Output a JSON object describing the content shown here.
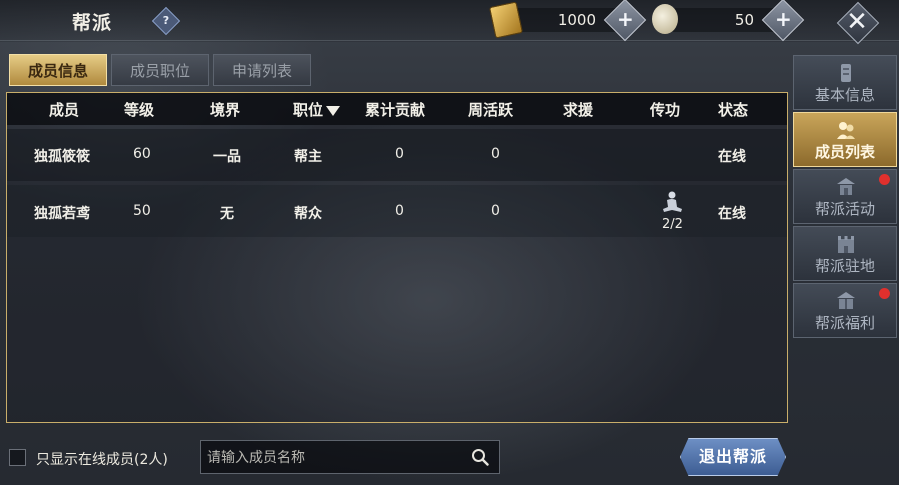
{
  "window": {
    "title": "帮派",
    "help_symbol": "?"
  },
  "resources": {
    "gold": {
      "icon": "gold-ingot-icon",
      "value": "1000"
    },
    "silver": {
      "icon": "silver-coin-icon",
      "value": "50"
    },
    "add_symbol": "+"
  },
  "close_symbol": "✕",
  "tabs": [
    {
      "label": "成员信息",
      "active": true
    },
    {
      "label": "成员职位",
      "active": false
    },
    {
      "label": "申请列表",
      "active": false
    }
  ],
  "table": {
    "columns": [
      "成员",
      "等级",
      "境界",
      "职位",
      "累计贡献",
      "周活跃",
      "求援",
      "传功",
      "状态"
    ],
    "rows": [
      {
        "name": "独孤筱筱",
        "level": "60",
        "realm": "一品",
        "position": "帮主",
        "contribution": "0",
        "weekly_active": "0",
        "assist": "",
        "teach": "",
        "status": "在线"
      },
      {
        "name": "独孤若鸢",
        "level": "50",
        "realm": "无",
        "position": "帮众",
        "contribution": "0",
        "weekly_active": "0",
        "assist": "",
        "teach": "2/2",
        "status": "在线"
      }
    ]
  },
  "side_nav": [
    {
      "label": "基本信息",
      "icon": "info-scroll-icon",
      "active": false,
      "badge": false
    },
    {
      "label": "成员列表",
      "icon": "members-icon",
      "active": true,
      "badge": false
    },
    {
      "label": "帮派活动",
      "icon": "pavilion-icon",
      "active": false,
      "badge": true
    },
    {
      "label": "帮派驻地",
      "icon": "castle-icon",
      "active": false,
      "badge": false
    },
    {
      "label": "帮派福利",
      "icon": "gift-icon",
      "active": false,
      "badge": true
    }
  ],
  "bottom": {
    "online_only_label": "只显示在线成员(2人)",
    "search_placeholder": "请输入成员名称",
    "quit_label": "退出帮派"
  },
  "colors": {
    "accent_gold": "#c9ae6a",
    "badge_red": "#e0302d",
    "quit_blue": "#4f70a8"
  }
}
